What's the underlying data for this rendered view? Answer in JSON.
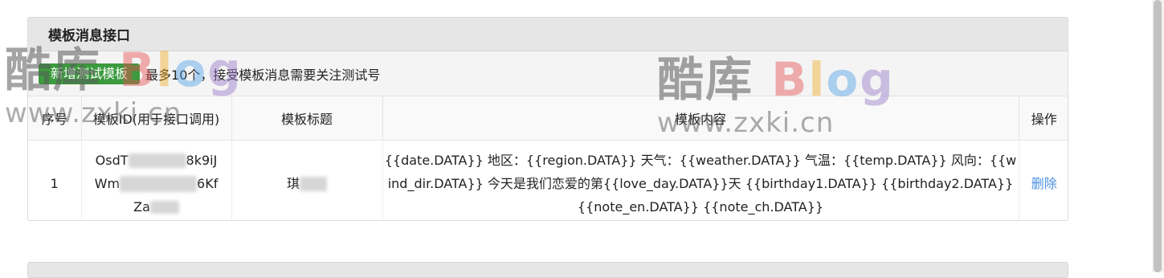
{
  "panel": {
    "title": "模板消息接口",
    "add_button": "新增测试模板",
    "note": "最多10个，接受模板消息需要关注测试号"
  },
  "table": {
    "headers": [
      "序号",
      "模板ID(用于接口调用)",
      "模板标题",
      "模板内容",
      "操作"
    ],
    "rows": [
      {
        "index": "1",
        "template_id": {
          "line1_start": "OsdT",
          "line1_end": "8k9iJ",
          "line2_start": "Wm",
          "line2_end": "6Kf",
          "line3_start": "Za",
          "line3_end": ""
        },
        "title_visible": "琪",
        "content": "{{date.DATA}} 地区：{{region.DATA}} 天气：{{weather.DATA}} 气温：{{temp.DATA}} 风向：{{wind_dir.DATA}} 今天是我们恋爱的第{{love_day.DATA}}天 {{birthday1.DATA}} {{birthday2.DATA}} {{note_en.DATA}} {{note_ch.DATA}}",
        "action": "删除"
      }
    ]
  },
  "watermark": {
    "brand_cn": "酷库",
    "brand_en_b": "B",
    "brand_en_l": "l",
    "brand_en_o": "o",
    "brand_en_g": "g",
    "url": "www.zxki.cn"
  },
  "colors": {
    "button_green": "#3c9a3f",
    "link_blue": "#4a90e2",
    "header_gray": "#e6e6e6"
  }
}
